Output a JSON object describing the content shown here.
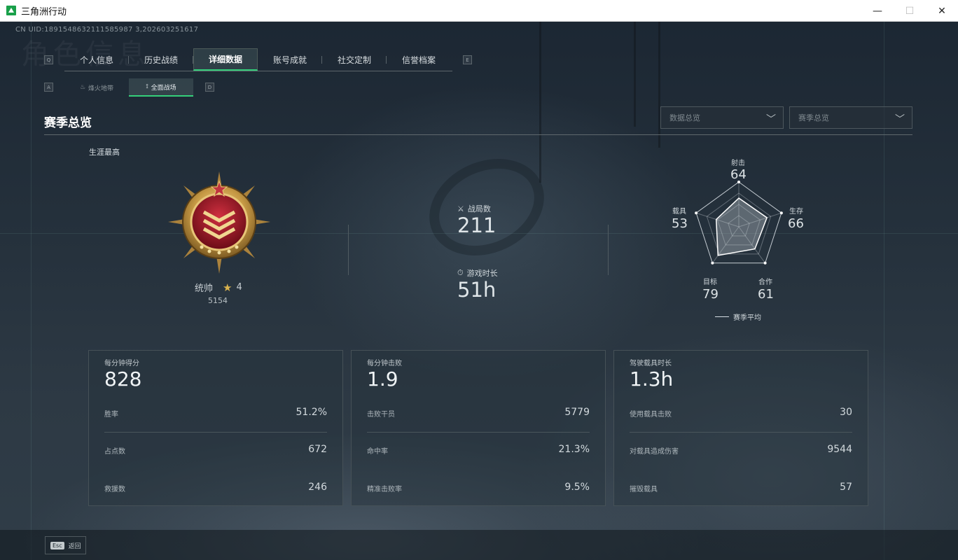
{
  "window": {
    "title": "三角洲行动",
    "controls": {
      "minimize": "—",
      "maximize": "☐",
      "close": "✕"
    }
  },
  "background_text": "角色信息",
  "uid": "CN UID:1891548632111585987 3,202603251617",
  "key_hints": {
    "prev_tab": "Q",
    "next_tab": "E",
    "prev_sub": "A",
    "next_sub": "D"
  },
  "main_tabs": [
    {
      "label": "个人信息",
      "active": false
    },
    {
      "label": "历史战绩",
      "active": false
    },
    {
      "label": "详细数据",
      "active": true
    },
    {
      "label": "账号成就",
      "active": false
    },
    {
      "label": "社交定制",
      "active": false
    },
    {
      "label": "信誉档案",
      "active": false
    }
  ],
  "sub_tabs": [
    {
      "label": "烽火地带",
      "icon": "flame-icon",
      "active": false
    },
    {
      "label": "全面战场",
      "icon": "battlefield-icon",
      "active": true
    }
  ],
  "page_title": "赛季总览",
  "dropdowns": [
    {
      "value": "数据总览"
    },
    {
      "value": "赛季总览"
    }
  ],
  "career": {
    "label": "生涯最高",
    "rank_name": "统帅",
    "rank_stars": "4",
    "rank_score": "5154"
  },
  "mid_stats": {
    "matches_label": "战局数",
    "matches_value": "211",
    "playtime_label": "游戏时长",
    "playtime_value": "51h"
  },
  "radar": {
    "axes": [
      {
        "label": "射击",
        "value": "64"
      },
      {
        "label": "生存",
        "value": "66"
      },
      {
        "label": "合作",
        "value": "61"
      },
      {
        "label": "目标",
        "value": "79"
      },
      {
        "label": "载具",
        "value": "53"
      }
    ],
    "legend": "赛季平均",
    "colors": {
      "fill": "#c9d1d6",
      "web": "#d6dde2"
    }
  },
  "cards": [
    {
      "title": "每分钟得分",
      "value": "828",
      "rows": [
        {
          "label": "胜率",
          "value": "51.2%"
        },
        {
          "label": "占点数",
          "value": "672"
        },
        {
          "label": "救援数",
          "value": "246"
        }
      ]
    },
    {
      "title": "每分钟击败",
      "value": "1.9",
      "rows": [
        {
          "label": "击败干员",
          "value": "5779"
        },
        {
          "label": "命中率",
          "value": "21.3%"
        },
        {
          "label": "精准击败率",
          "value": "9.5%"
        }
      ]
    },
    {
      "title": "驾驶载具时长",
      "value": "1.3h",
      "rows": [
        {
          "label": "使用载具击败",
          "value": "30"
        },
        {
          "label": "对载具造成伤害",
          "value": "9544"
        },
        {
          "label": "摧毁载具",
          "value": "57"
        }
      ]
    }
  ],
  "footer": {
    "esc_key": "Esc",
    "esc_label": "返回"
  },
  "accent_color": "#34d07a"
}
